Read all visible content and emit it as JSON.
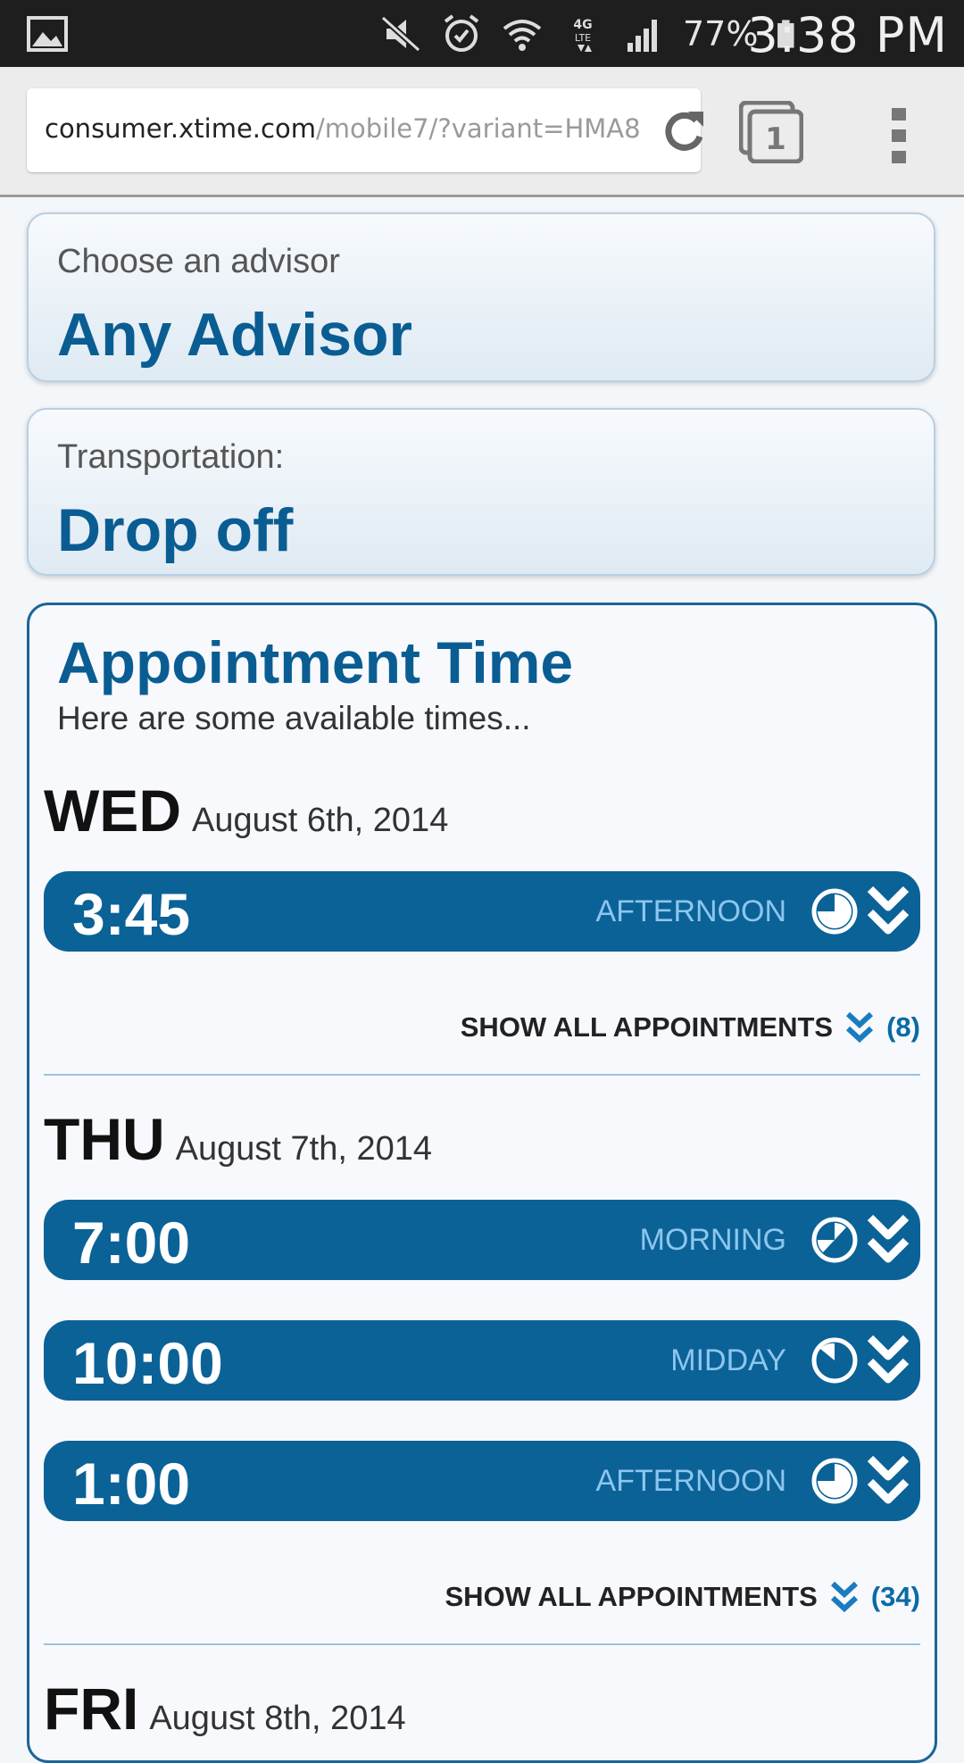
{
  "status_bar": {
    "battery_percent": "77%",
    "time": "3:38 PM",
    "network": "4G LTE",
    "icons": [
      "gallery-icon",
      "mute-icon",
      "alarm-icon",
      "wifi-icon",
      "lte-icon",
      "signal-icon",
      "battery-icon"
    ]
  },
  "browser": {
    "url_host": "consumer.xtime.com",
    "url_path": "/mobile7/?variant=HMA8",
    "tab_count": "1"
  },
  "advisor": {
    "label": "Choose an advisor",
    "value": "Any Advisor"
  },
  "transportation": {
    "label": "Transportation:",
    "value": "Drop off"
  },
  "appointment": {
    "title": "Appointment Time",
    "subtitle": "Here are some available times...",
    "show_all_label": "SHOW ALL APPOINTMENTS",
    "days": [
      {
        "abbr": "WED",
        "date": "August 6th, 2014",
        "slots": [
          {
            "time": "3:45",
            "period": "AFTERNOON"
          }
        ],
        "count": "(8)"
      },
      {
        "abbr": "THU",
        "date": "August 7th, 2014",
        "slots": [
          {
            "time": "7:00",
            "period": "MORNING"
          },
          {
            "time": "10:00",
            "period": "MIDDAY"
          },
          {
            "time": "1:00",
            "period": "AFTERNOON"
          }
        ],
        "count": "(34)"
      },
      {
        "abbr": "FRI",
        "date": "August 8th, 2014"
      }
    ]
  },
  "colors": {
    "brand_blue": "#0b6297",
    "period_text": "#8cc6ee"
  }
}
